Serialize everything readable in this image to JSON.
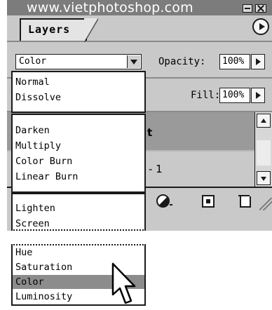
{
  "window": {
    "watermark": "www.vietphotoshop.com",
    "tab_label": "Layers"
  },
  "controls": {
    "blend_mode": "Color",
    "opacity_label": "Opacity:",
    "opacity_value": "100%",
    "fill_label": "Fill:",
    "fill_value": "100%"
  },
  "layers": {
    "selected_partial_name": "t",
    "second_partial_name": "- 1"
  },
  "blend_menu": {
    "group1": [
      "Normal",
      "Dissolve"
    ],
    "group2": [
      "Darken",
      "Multiply",
      "Color Burn",
      "Linear Burn"
    ],
    "group3": [
      "Lighten",
      "Screen"
    ],
    "group4": [
      "Hue",
      "Saturation",
      "Color",
      "Luminosity"
    ],
    "selected": "Color"
  },
  "icons": [
    "minimize-icon",
    "close-icon",
    "palette-menu-icon",
    "dropdown-arrow-icon",
    "adjustment-layer-icon",
    "new-layer-icon",
    "trash-icon",
    "resize-grip-icon",
    "mouse-pointer-icon"
  ]
}
